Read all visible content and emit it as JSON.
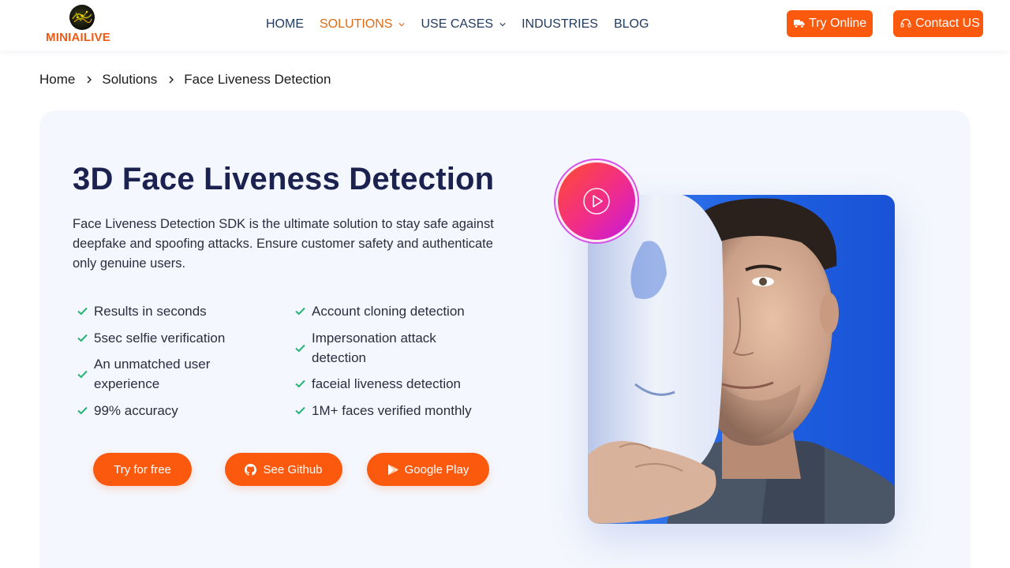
{
  "header": {
    "logo_text": "MINIAILIVE",
    "nav": [
      {
        "label": "HOME",
        "active": false,
        "dropdown": false
      },
      {
        "label": "SOLUTIONS",
        "active": true,
        "dropdown": true
      },
      {
        "label": "USE CASES",
        "active": false,
        "dropdown": true
      },
      {
        "label": "INDUSTRIES",
        "active": false,
        "dropdown": false
      },
      {
        "label": "BLOG",
        "active": false,
        "dropdown": false
      }
    ],
    "try_online_label": "Try Online",
    "contact_label": "Contact US"
  },
  "breadcrumb": [
    "Home",
    "Solutions",
    "Face Liveness Detection"
  ],
  "hero": {
    "title": "3D Face Liveness Detection",
    "description": "Face Liveness Detection SDK is the ultimate solution to stay safe against deepfake and spoofing attacks. Ensure customer safety and authenticate only genuine users.",
    "features_left": [
      "Results in seconds",
      "5sec selfie verification",
      "An unmatched user experience",
      "99% accuracy"
    ],
    "features_right": [
      "Account cloning detection",
      "Impersonation attack detection",
      "faceial liveness detection",
      "1M+ faces verified monthly"
    ],
    "buttons": {
      "try_free": "Try for free",
      "github": "See Github",
      "google_play": "Google Play"
    }
  },
  "colors": {
    "accent": "#fb5a0e",
    "nav_active": "#e06a12",
    "nav_text": "#1f3a5f",
    "title": "#1c2250",
    "check": "#22b573",
    "hero_bg": "#f4f7fd"
  },
  "icons": {
    "try_online": "truck-icon",
    "contact": "headset-icon",
    "github": "github-icon",
    "google_play": "google-play-icon",
    "video": "play-circle-icon",
    "feature": "check-icon"
  }
}
